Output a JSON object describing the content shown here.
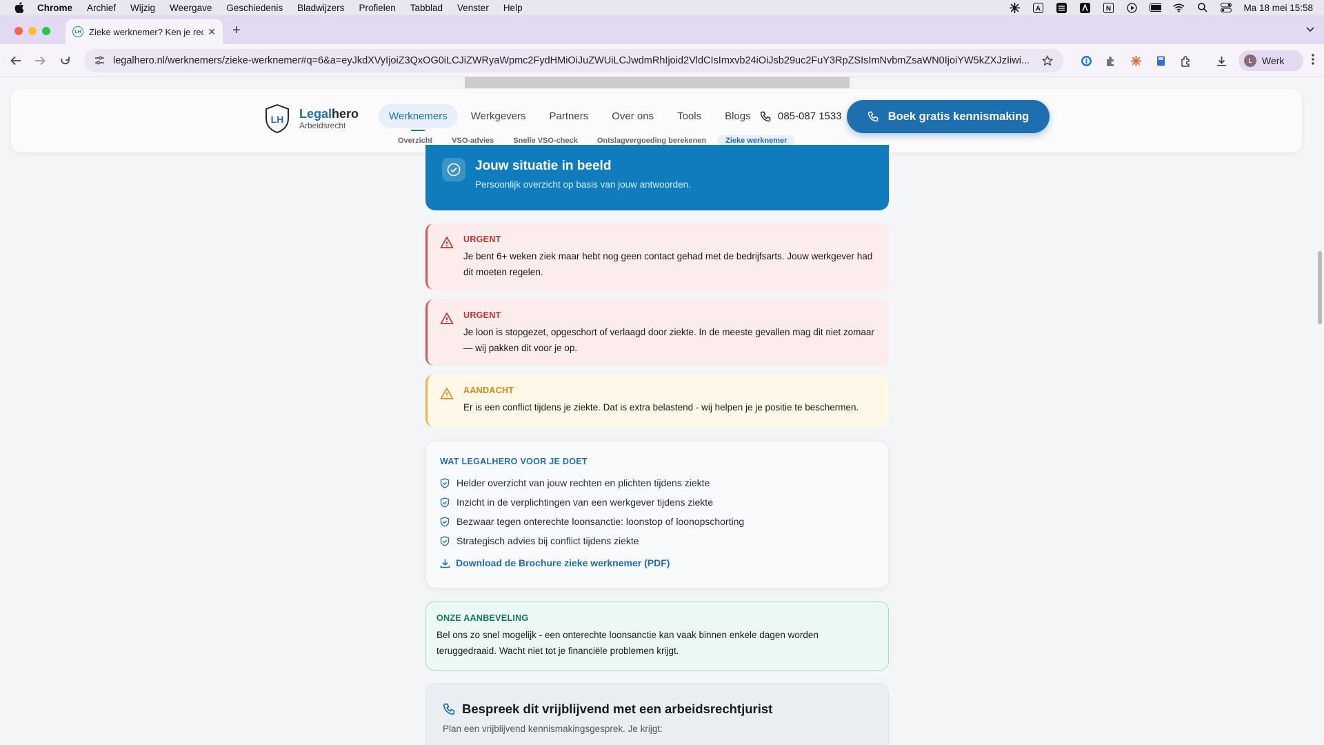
{
  "menubar": {
    "app": "Chrome",
    "items": [
      "Archief",
      "Wijzig",
      "Weergave",
      "Geschiedenis",
      "Bladwijzers",
      "Profielen",
      "Tabblad",
      "Venster",
      "Help"
    ],
    "datetime": "Ma 18 mei  15:58"
  },
  "browser": {
    "tab_title": "Zieke werknemer? Ken je rech",
    "tab_favicon": "LH",
    "url": "legalhero.nl/werknemers/zieke-werknemer#q=6&a=eyJkdXVyIjoiZ3QxOG0iLCJiZWRyaWpmc2FydHMiOiJuZWUiLCJwdmRhIjoid2VldCIsImxvb24iOiJsb29uc2FuY3RpZSIsImNvbmZsaWN0IjoiYW5kZXJzIiwi...",
    "profile_initial": "L",
    "profile_label": "Werk"
  },
  "site": {
    "logo_mark": "LH",
    "brand_part1": "Legal",
    "brand_part2": "hero",
    "brand_sub": "Arbeidsrecht",
    "nav": [
      "Werknemers",
      "Werkgevers",
      "Partners",
      "Over ons",
      "Tools",
      "Blogs"
    ],
    "phone": "085-087 1533",
    "cta": "Boek gratis kennismaking",
    "subnav": [
      "Overzicht",
      "VSO-advies",
      "Snelle VSO-check",
      "Ontslagvergoeding berekenen",
      "Zieke werknemer"
    ]
  },
  "hero": {
    "title": "Jouw situatie in beeld",
    "subtitle": "Persoonlijk overzicht op basis van jouw antwoorden."
  },
  "alerts": [
    {
      "label": "URGENT",
      "text": "Je bent 6+ weken ziek maar hebt nog geen contact gehad met de bedrijfsarts. Jouw werkgever had dit moeten regelen."
    },
    {
      "label": "URGENT",
      "text": "Je loon is stopgezet, opgeschort of verlaagd door ziekte. In de meeste gevallen mag dit niet zomaar — wij pakken dit voor je op."
    },
    {
      "label": "AANDACHT",
      "text": "Er is een conflict tijdens je ziekte. Dat is extra belastend - wij helpen je je positie te beschermen."
    }
  ],
  "services": {
    "title": "WAT LEGALHERO VOOR JE DOET",
    "items": [
      "Helder overzicht van jouw rechten en plichten tijdens ziekte",
      "Inzicht in de verplichtingen van een werkgever tijdens ziekte",
      "Bezwaar tegen onterechte loonsanctie: loonstop of loonopschorting",
      "Strategisch advies bij conflict tijdens ziekte"
    ],
    "download": "Download de Brochure zieke werknemer (PDF)"
  },
  "recommendation": {
    "title": "ONZE AANBEVELING",
    "text": "Bel ons zo snel mogelijk - een onterechte loonsanctie kan vaak binnen enkele dagen worden teruggedraaid. Wacht niet tot je financiële problemen krijgt."
  },
  "contact": {
    "title": "Bespreek dit vrijblijvend met een arbeidsrechtjurist",
    "subtitle": "Plan een vrijblijvend kennismakingsgesprek. Je krijgt:"
  },
  "colors": {
    "brand": "#1d6fb0",
    "hero": "#0f7dbd",
    "urgent": "#c8302f",
    "attention": "#d98a17",
    "recommendation": "#0f7a57"
  }
}
